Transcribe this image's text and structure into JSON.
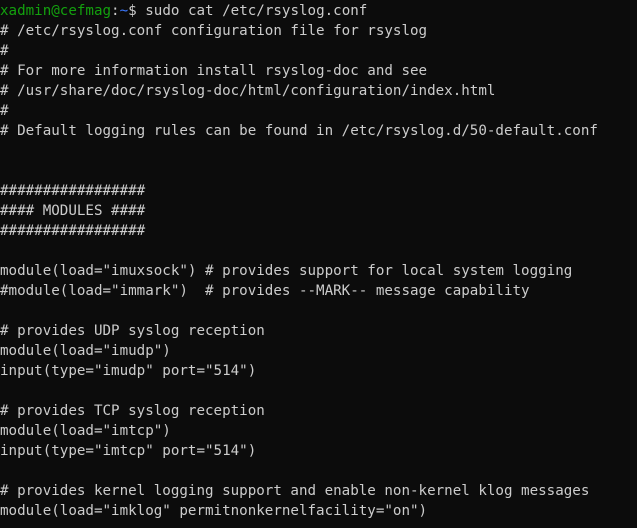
{
  "terminal": {
    "prompt": {
      "user_host": "xadmin@cefmag",
      "separator": ":",
      "path": "~",
      "symbol": "$ ",
      "command": "sudo cat /etc/rsyslog.conf"
    },
    "output": [
      "# /etc/rsyslog.conf configuration file for rsyslog",
      "#",
      "# For more information install rsyslog-doc and see",
      "# /usr/share/doc/rsyslog-doc/html/configuration/index.html",
      "#",
      "# Default logging rules can be found in /etc/rsyslog.d/50-default.conf",
      "",
      "",
      "#################",
      "#### MODULES ####",
      "#################",
      "",
      "module(load=\"imuxsock\") # provides support for local system logging",
      "#module(load=\"immark\")  # provides --MARK-- message capability",
      "",
      "# provides UDP syslog reception",
      "module(load=\"imudp\")",
      "input(type=\"imudp\" port=\"514\")",
      "",
      "# provides TCP syslog reception",
      "module(load=\"imtcp\")",
      "input(type=\"imtcp\" port=\"514\")",
      "",
      "# provides kernel logging support and enable non-kernel klog messages",
      "module(load=\"imklog\" permitnonkernelfacility=\"on\")"
    ]
  },
  "colors": {
    "background": "#0c0c0c",
    "text": "#cccccc",
    "user_host": "#13a10e",
    "path": "#3b78ff"
  }
}
